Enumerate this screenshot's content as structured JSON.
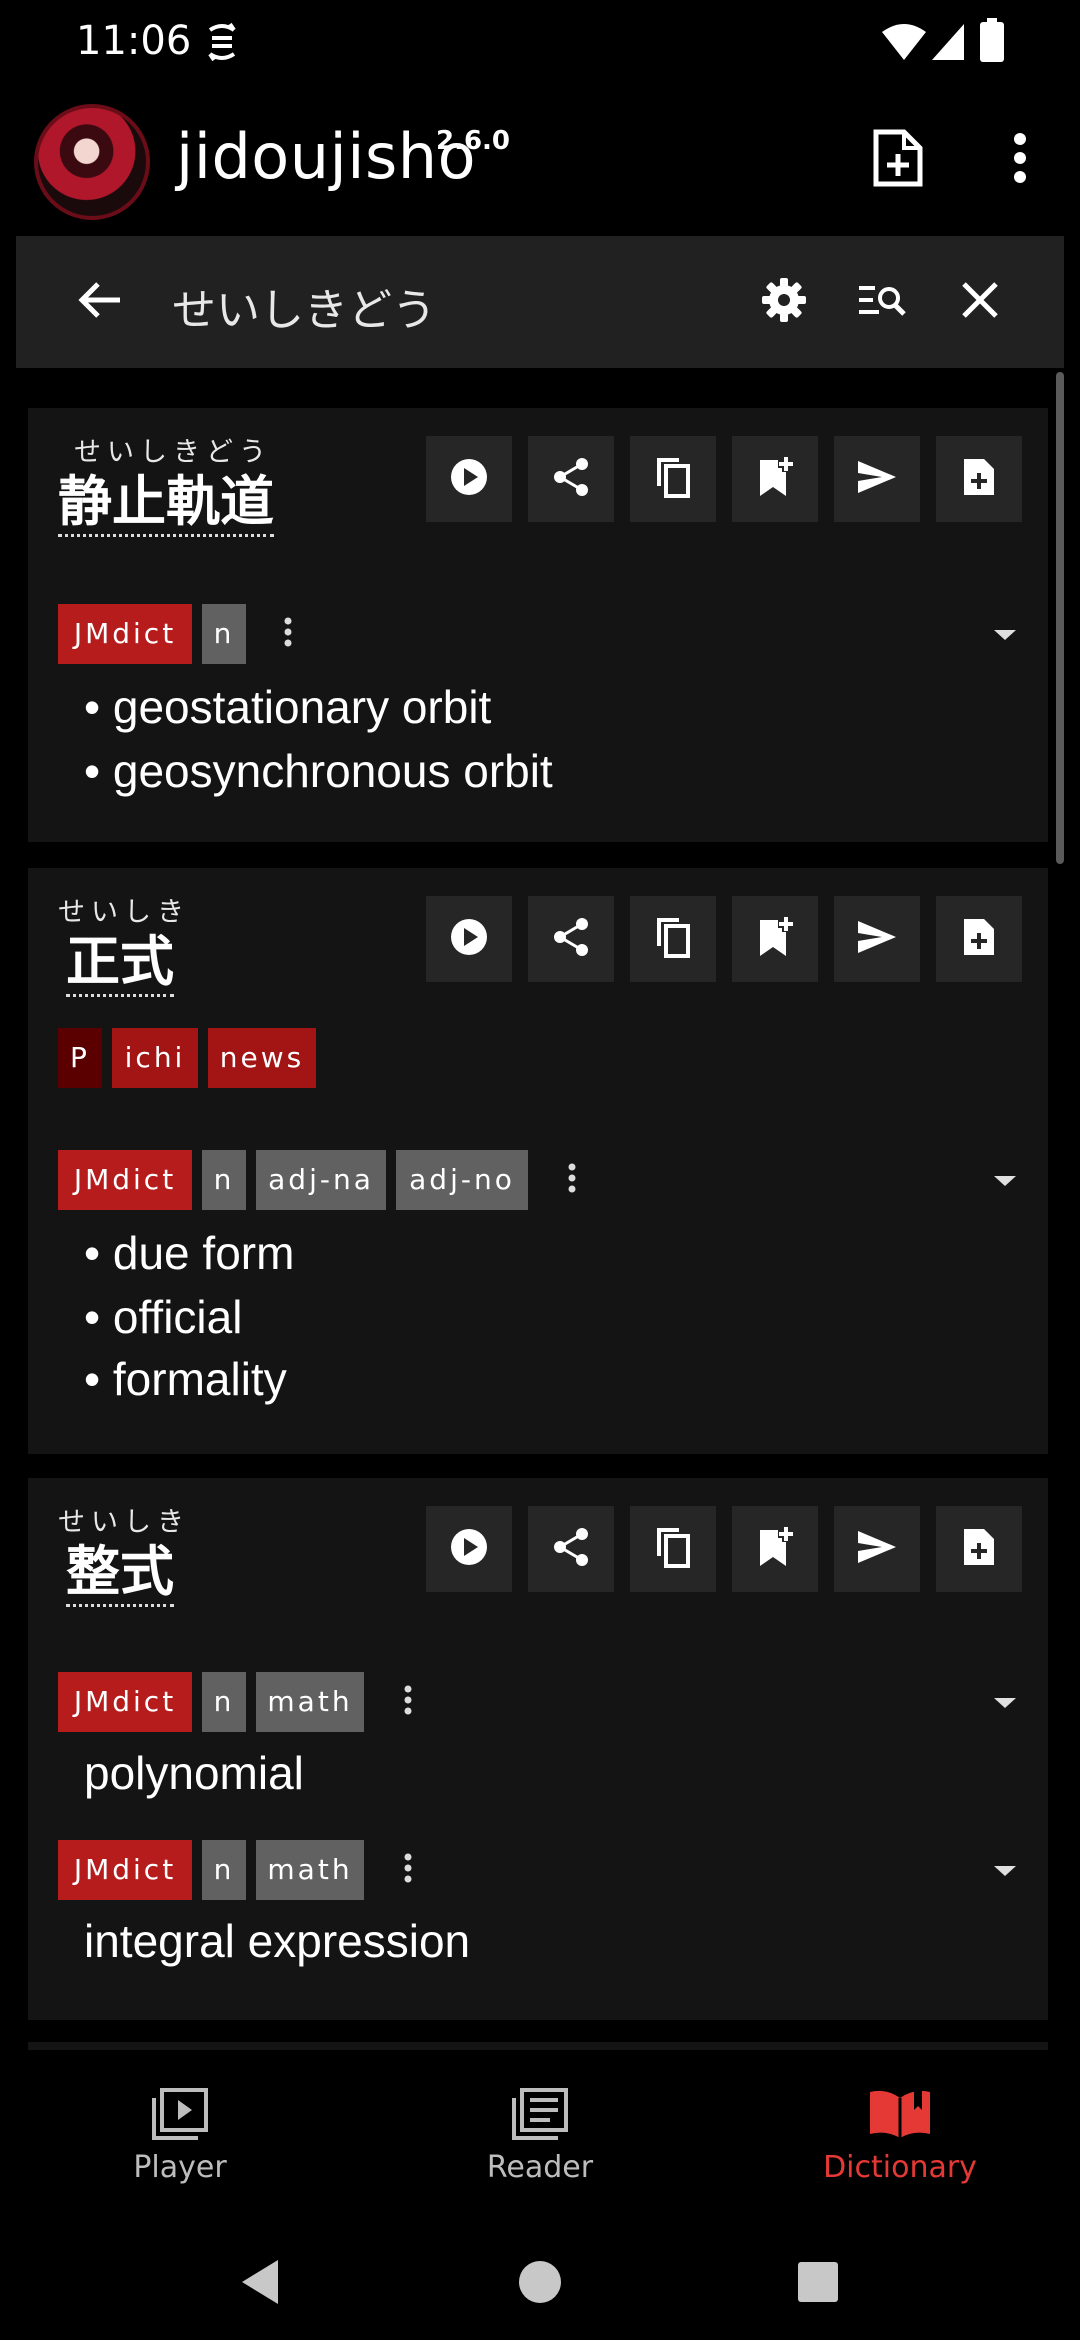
{
  "status_bar": {
    "time": "11:06"
  },
  "app": {
    "title": "jidoujisho",
    "version": "2.6.0"
  },
  "search": {
    "query": "せいしきどう"
  },
  "entries": [
    {
      "reading": "せいしきどう",
      "term": "静止軌道",
      "meanings": [
        {
          "dictionary": "JMdict",
          "tags": [
            "n"
          ],
          "glosses": [
            "• geostationary orbit",
            "• geosynchronous orbit"
          ]
        }
      ]
    },
    {
      "reading": "せいしき",
      "term": "正式",
      "frequency_tags": [
        "P",
        "ichi",
        "news"
      ],
      "meanings": [
        {
          "dictionary": "JMdict",
          "tags": [
            "n",
            "adj-na",
            "adj-no"
          ],
          "glosses": [
            "• due form",
            "• official",
            "• formality"
          ]
        }
      ]
    },
    {
      "reading": "せいしき",
      "term": "整式",
      "meanings": [
        {
          "dictionary": "JMdict",
          "tags": [
            "n",
            "math"
          ],
          "glosses": [
            "polynomial"
          ]
        },
        {
          "dictionary": "JMdict",
          "tags": [
            "n",
            "math"
          ],
          "glosses": [
            "integral expression"
          ]
        }
      ]
    }
  ],
  "bottom_nav": [
    {
      "label": "Player",
      "icon": "player-icon"
    },
    {
      "label": "Reader",
      "icon": "reader-icon"
    },
    {
      "label": "Dictionary",
      "icon": "dictionary-icon",
      "active": true
    }
  ],
  "colors": {
    "accent": "#e53935",
    "dictionary_tag": "#b71c1c",
    "pos_tag": "#616161",
    "card": "#141414"
  }
}
